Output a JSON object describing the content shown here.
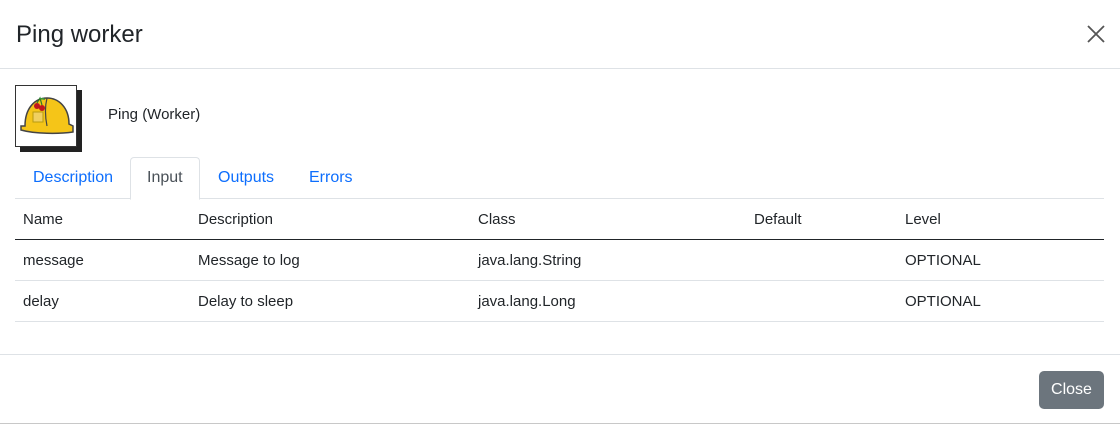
{
  "modal": {
    "title": "Ping worker",
    "worker_label": "Ping (Worker)",
    "icon": "hard-hat-icon"
  },
  "tabs": [
    {
      "label": "Description",
      "active": false
    },
    {
      "label": "Input",
      "active": true
    },
    {
      "label": "Outputs",
      "active": false
    },
    {
      "label": "Errors",
      "active": false
    }
  ],
  "table": {
    "headers": [
      "Name",
      "Description",
      "Class",
      "Default",
      "Level"
    ],
    "rows": [
      [
        "message",
        "Message to log",
        "java.lang.String",
        "",
        "OPTIONAL"
      ],
      [
        "delay",
        "Delay to sleep",
        "java.lang.Long",
        "",
        "OPTIONAL"
      ]
    ]
  },
  "footer": {
    "close_label": "Close"
  },
  "colors": {
    "link": "#0d6efd",
    "close_button": "#6c757d"
  }
}
